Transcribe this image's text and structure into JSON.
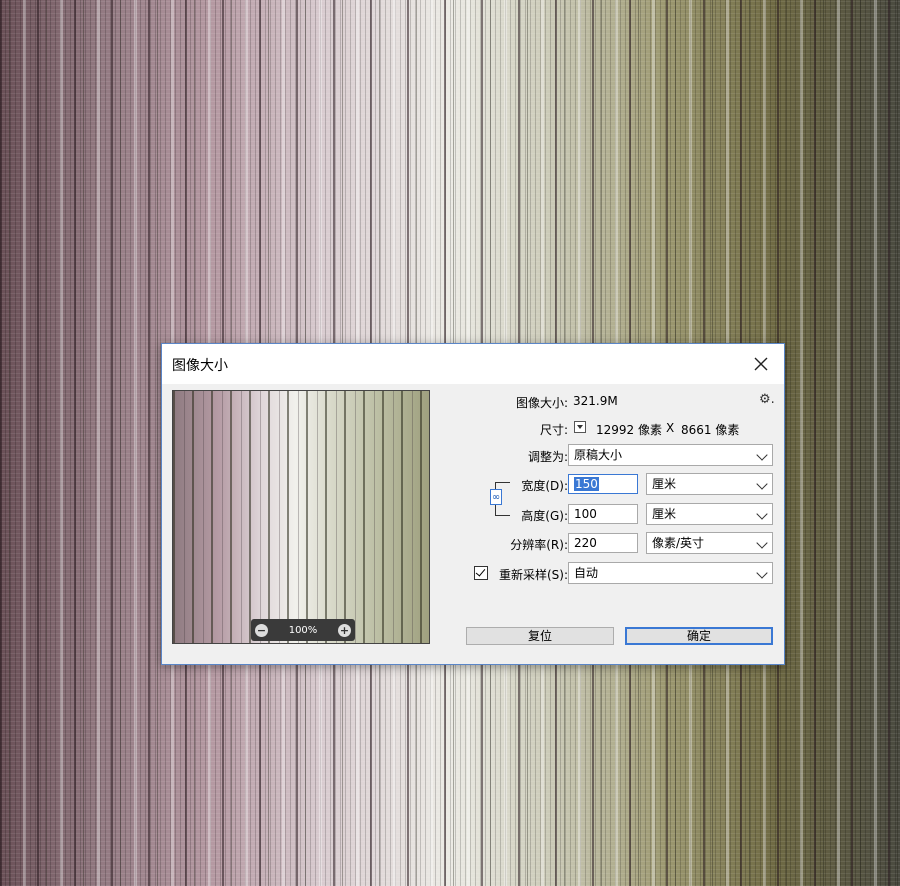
{
  "dialog": {
    "title": "图像大小",
    "image_size_label": "图像大小:",
    "image_size_value": "321.9M",
    "dimensions_label": "尺寸:",
    "dimensions_width": "12992 像素",
    "dimensions_sep": "X",
    "dimensions_height": "8661 像素",
    "fit_to_label": "调整为:",
    "fit_to_value": "原稿大小",
    "width_label": "宽度(D):",
    "width_value": "150",
    "width_unit": "厘米",
    "height_label": "高度(G):",
    "height_value": "100",
    "height_unit": "厘米",
    "resolution_label": "分辨率(R):",
    "resolution_value": "220",
    "resolution_unit": "像素/英寸",
    "resample_label": "重新采样(S):",
    "resample_checked": true,
    "resample_value": "自动",
    "reset_button": "复位",
    "ok_button": "确定"
  },
  "preview": {
    "zoom": "100%",
    "zoom_out": "−",
    "zoom_in": "+"
  },
  "icons": {
    "close": "close-icon",
    "gear": "gear-icon",
    "link": "link-icon"
  },
  "colors": {
    "accent": "#3a78d4",
    "dialog_bg": "#f0f0f0"
  }
}
